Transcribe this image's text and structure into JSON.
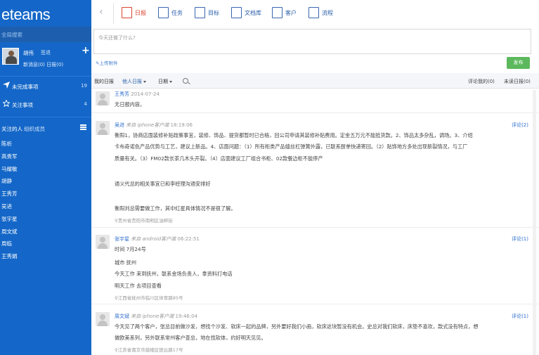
{
  "sidebar": {
    "logo": "eteams",
    "search": "全局搜索",
    "user": {
      "name": "胡伟",
      "action": "签退",
      "plus": "+",
      "messages": "新消息(0) 日报(0)"
    },
    "nav": [
      {
        "label": "未完成事项",
        "count": "19",
        "icon": "send-icon"
      },
      {
        "label": "关注事项",
        "count": "4",
        "icon": "star-icon"
      }
    ],
    "follow": {
      "tab_a": "关注的人",
      "tab_b": "组织成员"
    },
    "people": [
      "陈析",
      "高贵军",
      "马耀敏",
      "胡静",
      "王秀芳",
      "吴进",
      "张宇星",
      "周文斌",
      "周临",
      "王秀娟"
    ]
  },
  "topbar": {
    "back": "‹",
    "tabs": [
      {
        "label": "日报",
        "icon": "report-icon"
      },
      {
        "label": "任务",
        "icon": "task-icon"
      },
      {
        "label": "目标",
        "icon": "target-icon"
      },
      {
        "label": "文档库",
        "icon": "document-icon"
      },
      {
        "label": "客户",
        "icon": "customer-icon"
      },
      {
        "label": "流程",
        "icon": "workflow-icon"
      }
    ]
  },
  "composer": {
    "placeholder": "今天还做了什么?",
    "attach": "上传附件",
    "publish": "发布"
  },
  "filter": {
    "my_report": "我的日报",
    "others_report": "他人日报",
    "date": "日期",
    "comment_me": "评论我的(0)",
    "unread": "未读日报(0)"
  },
  "entries": [
    {
      "name": "王秀芳",
      "source": "",
      "time": "2014-07-24",
      "lines": [
        "无日报内容。"
      ],
      "location": "",
      "comment": ""
    },
    {
      "name": "吴进",
      "source": "来自 iphone客户端",
      "time": "18:19:06",
      "lines": [
        "衡阳1，协商店面装修补贴政策事宜，装修、饰品、提货都暂时已合格，回公司申请其装修补贴费用。定金五万元不能抵货款。2、饰品太多杂乱，调场。3、介绍",
        "卡布奇诺色产品优势与工艺，建议上新品。4、店面问题：（1）所有柜类产品缝丝杠弹簧外露，已联系厨单快递寄回。（2）贴饰地方多处出现新裂情况，与工厂",
        "质量有关。（3）FM02款长茶几木头开裂。（4）店面建议工厂组合书柜、02款餐边柜不能停产",
        "",
        "通义代总的相关事宜已和李经理沟通安排好",
        "",
        "衡阳刘总需要做工作，其中红星具体情况不是很了解。"
      ],
      "location": "贵州省贵阳市南明区油榨街",
      "comment": "评论(2)"
    },
    {
      "name": "张宇星",
      "source": "来自 android客户端",
      "time": "06:22:51",
      "lines": [
        "时间 7月24号",
        "城市 抚州",
        "今天工作 来到抚州，联系金场负责人，拿资料打电话",
        "明天工作 去项目查看"
      ],
      "location": "江西省抚州市临川区体育路85号",
      "comment": "评论(1)"
    },
    {
      "name": "周文斌",
      "source": "来自 iphone客户端",
      "time": "19:46:04",
      "lines": [
        "今天见了两个客户，张总目前做沙发，想找个沙发、软床一起的品牌，另外要好我们小画，软床这块暂没有机会。史总对我们软床，床垫不喜欢，款式没有特点，想",
        "做欧美系列，另外联系常州客户查总，地在找软体，约好明天见见。"
      ],
      "location": "江苏省南京市鼓楼区德云路17号",
      "comment": "评论(1)"
    }
  ]
}
